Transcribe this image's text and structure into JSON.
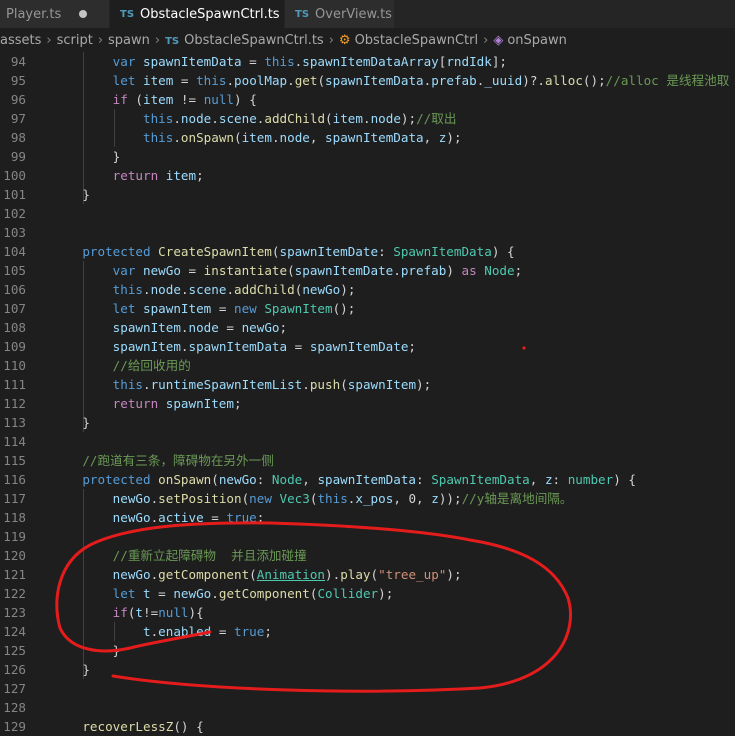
{
  "tabs": [
    {
      "label": "Player.ts",
      "icon": "ts-file-icon",
      "modified": true,
      "active": false
    },
    {
      "label": "ObstacleSpawnCtrl.ts",
      "icon": "ts-file-icon",
      "modified": true,
      "active": true
    },
    {
      "label": "OverView.ts",
      "icon": "ts-file-icon",
      "modified": false,
      "active": false
    }
  ],
  "breadcrumb": {
    "items": [
      "assets",
      "script",
      "spawn",
      "ObstacleSpawnCtrl.ts",
      "ObstacleSpawnCtrl",
      "onSpawn"
    ],
    "ts_label": "TS"
  },
  "annotation": {
    "color": "#e51c1c",
    "shape": "hand-drawn-ellipse"
  },
  "marker_dot": {
    "color": "#e51c1c"
  },
  "lines": [
    {
      "n": "94",
      "t": [
        [
          "kw",
          "        var "
        ],
        [
          "va",
          "spawnItemData"
        ],
        [
          "pl",
          " = "
        ],
        [
          "kw",
          "this"
        ],
        [
          "pl",
          "."
        ],
        [
          "va",
          "spawnItemDataArray"
        ],
        [
          "pl",
          "["
        ],
        [
          "va",
          "rndIdk"
        ],
        [
          "pl",
          "];"
        ]
      ]
    },
    {
      "n": "95",
      "t": [
        [
          "kw",
          "        let "
        ],
        [
          "va",
          "item"
        ],
        [
          "pl",
          " = "
        ],
        [
          "kw",
          "this"
        ],
        [
          "pl",
          "."
        ],
        [
          "va",
          "poolMap"
        ],
        [
          "pl",
          "."
        ],
        [
          "fn",
          "get"
        ],
        [
          "pl",
          "("
        ],
        [
          "va",
          "spawnItemData"
        ],
        [
          "pl",
          "."
        ],
        [
          "va",
          "prefab"
        ],
        [
          "pl",
          "."
        ],
        [
          "va",
          "_uuid"
        ],
        [
          "pl",
          ")?."
        ],
        [
          "fn",
          "alloc"
        ],
        [
          "pl",
          "();"
        ],
        [
          "cm",
          "//alloc 是线程池取"
        ]
      ]
    },
    {
      "n": "96",
      "t": [
        [
          "ct",
          "        if "
        ],
        [
          "pl",
          "("
        ],
        [
          "va",
          "item"
        ],
        [
          "pl",
          " != "
        ],
        [
          "kw",
          "null"
        ],
        [
          "pl",
          ") {"
        ]
      ]
    },
    {
      "n": "97",
      "t": [
        [
          "kw",
          "            this"
        ],
        [
          "pl",
          "."
        ],
        [
          "va",
          "node"
        ],
        [
          "pl",
          "."
        ],
        [
          "va",
          "scene"
        ],
        [
          "pl",
          "."
        ],
        [
          "fn",
          "addChild"
        ],
        [
          "pl",
          "("
        ],
        [
          "va",
          "item"
        ],
        [
          "pl",
          "."
        ],
        [
          "va",
          "node"
        ],
        [
          "pl",
          ");"
        ],
        [
          "cm",
          "//取出"
        ]
      ]
    },
    {
      "n": "98",
      "t": [
        [
          "kw",
          "            this"
        ],
        [
          "pl",
          "."
        ],
        [
          "fn",
          "onSpawn"
        ],
        [
          "pl",
          "("
        ],
        [
          "va",
          "item"
        ],
        [
          "pl",
          "."
        ],
        [
          "va",
          "node"
        ],
        [
          "pl",
          ", "
        ],
        [
          "va",
          "spawnItemData"
        ],
        [
          "pl",
          ", "
        ],
        [
          "va",
          "z"
        ],
        [
          "pl",
          ");"
        ]
      ]
    },
    {
      "n": "99",
      "t": [
        [
          "pl",
          "        }"
        ]
      ]
    },
    {
      "n": "100",
      "t": [
        [
          "ct",
          "        return "
        ],
        [
          "va",
          "item"
        ],
        [
          "pl",
          ";"
        ]
      ]
    },
    {
      "n": "101",
      "t": [
        [
          "pl",
          "    }"
        ]
      ]
    },
    {
      "n": "102",
      "t": []
    },
    {
      "n": "103",
      "t": []
    },
    {
      "n": "104",
      "t": [
        [
          "kw",
          "    protected "
        ],
        [
          "fn",
          "CreateSpawnItem"
        ],
        [
          "pl",
          "("
        ],
        [
          "va",
          "spawnItemDate"
        ],
        [
          "pl",
          ": "
        ],
        [
          "ty",
          "SpawnItemData"
        ],
        [
          "pl",
          ") {"
        ]
      ]
    },
    {
      "n": "105",
      "t": [
        [
          "kw",
          "        var "
        ],
        [
          "va",
          "newGo"
        ],
        [
          "pl",
          " = "
        ],
        [
          "fn",
          "instantiate"
        ],
        [
          "pl",
          "("
        ],
        [
          "va",
          "spawnItemDate"
        ],
        [
          "pl",
          "."
        ],
        [
          "va",
          "prefab"
        ],
        [
          "pl",
          ") "
        ],
        [
          "ct",
          "as "
        ],
        [
          "ty",
          "Node"
        ],
        [
          "pl",
          ";"
        ]
      ]
    },
    {
      "n": "106",
      "t": [
        [
          "kw",
          "        this"
        ],
        [
          "pl",
          "."
        ],
        [
          "va",
          "node"
        ],
        [
          "pl",
          "."
        ],
        [
          "va",
          "scene"
        ],
        [
          "pl",
          "."
        ],
        [
          "fn",
          "addChild"
        ],
        [
          "pl",
          "("
        ],
        [
          "va",
          "newGo"
        ],
        [
          "pl",
          ");"
        ]
      ]
    },
    {
      "n": "107",
      "t": [
        [
          "kw",
          "        let "
        ],
        [
          "va",
          "spawnItem"
        ],
        [
          "pl",
          " = "
        ],
        [
          "kw",
          "new "
        ],
        [
          "ty",
          "SpawnItem"
        ],
        [
          "pl",
          "();"
        ]
      ]
    },
    {
      "n": "108",
      "t": [
        [
          "va",
          "        spawnItem"
        ],
        [
          "pl",
          "."
        ],
        [
          "va",
          "node"
        ],
        [
          "pl",
          " = "
        ],
        [
          "va",
          "newGo"
        ],
        [
          "pl",
          ";"
        ]
      ]
    },
    {
      "n": "109",
      "t": [
        [
          "va",
          "        spawnItem"
        ],
        [
          "pl",
          "."
        ],
        [
          "va",
          "spawnItemData"
        ],
        [
          "pl",
          " = "
        ],
        [
          "va",
          "spawnItemDate"
        ],
        [
          "pl",
          ";"
        ]
      ]
    },
    {
      "n": "110",
      "t": [
        [
          "cm",
          "        //给回收用的"
        ]
      ]
    },
    {
      "n": "111",
      "t": [
        [
          "kw",
          "        this"
        ],
        [
          "pl",
          "."
        ],
        [
          "va",
          "runtimeSpawnItemList"
        ],
        [
          "pl",
          "."
        ],
        [
          "fn",
          "push"
        ],
        [
          "pl",
          "("
        ],
        [
          "va",
          "spawnItem"
        ],
        [
          "pl",
          ");"
        ]
      ]
    },
    {
      "n": "112",
      "t": [
        [
          "ct",
          "        return "
        ],
        [
          "va",
          "spawnItem"
        ],
        [
          "pl",
          ";"
        ]
      ]
    },
    {
      "n": "113",
      "t": [
        [
          "pl",
          "    }"
        ]
      ]
    },
    {
      "n": "114",
      "t": []
    },
    {
      "n": "115",
      "t": [
        [
          "cm",
          "    //跑道有三条，障碍物在另外一侧"
        ]
      ]
    },
    {
      "n": "116",
      "t": [
        [
          "kw",
          "    protected "
        ],
        [
          "fn",
          "onSpawn"
        ],
        [
          "pl",
          "("
        ],
        [
          "va",
          "newGo"
        ],
        [
          "pl",
          ": "
        ],
        [
          "ty",
          "Node"
        ],
        [
          "pl",
          ", "
        ],
        [
          "va",
          "spawnItemData"
        ],
        [
          "pl",
          ": "
        ],
        [
          "ty",
          "SpawnItemData"
        ],
        [
          "pl",
          ", "
        ],
        [
          "va",
          "z"
        ],
        [
          "pl",
          ": "
        ],
        [
          "ty",
          "number"
        ],
        [
          "pl",
          ") {"
        ]
      ]
    },
    {
      "n": "117",
      "t": [
        [
          "va",
          "        newGo"
        ],
        [
          "pl",
          "."
        ],
        [
          "fn",
          "setPosition"
        ],
        [
          "pl",
          "("
        ],
        [
          "kw",
          "new "
        ],
        [
          "ty",
          "Vec3"
        ],
        [
          "pl",
          "("
        ],
        [
          "kw",
          "this"
        ],
        [
          "pl",
          "."
        ],
        [
          "va",
          "x_pos"
        ],
        [
          "pl",
          ", 0, "
        ],
        [
          "va",
          "z"
        ],
        [
          "pl",
          "));"
        ],
        [
          "cm",
          "//y轴是离地间隔。"
        ]
      ]
    },
    {
      "n": "118",
      "t": [
        [
          "va",
          "        newGo"
        ],
        [
          "pl",
          "."
        ],
        [
          "va",
          "active"
        ],
        [
          "pl",
          " = "
        ],
        [
          "kw",
          "true"
        ],
        [
          "pl",
          ";"
        ]
      ]
    },
    {
      "n": "119",
      "t": []
    },
    {
      "n": "120",
      "t": [
        [
          "cm",
          "        //重新立起障碍物  并且添加碰撞"
        ]
      ]
    },
    {
      "n": "121",
      "t": [
        [
          "va",
          "        newGo"
        ],
        [
          "pl",
          "."
        ],
        [
          "fn",
          "getComponent"
        ],
        [
          "pl",
          "("
        ],
        [
          "ty ul",
          "Animation"
        ],
        [
          "pl",
          ")."
        ],
        [
          "fn",
          "play"
        ],
        [
          "pl",
          "("
        ],
        [
          "st",
          "\"tree_up\""
        ],
        [
          "pl",
          ");"
        ]
      ]
    },
    {
      "n": "122",
      "t": [
        [
          "kw",
          "        let "
        ],
        [
          "va",
          "t"
        ],
        [
          "pl",
          " = "
        ],
        [
          "va",
          "newGo"
        ],
        [
          "pl",
          "."
        ],
        [
          "fn",
          "getComponent"
        ],
        [
          "pl",
          "("
        ],
        [
          "ty",
          "Collider"
        ],
        [
          "pl",
          ");"
        ]
      ]
    },
    {
      "n": "123",
      "t": [
        [
          "ct",
          "        if"
        ],
        [
          "pl",
          "("
        ],
        [
          "va",
          "t"
        ],
        [
          "pl",
          "!="
        ],
        [
          "kw",
          "null"
        ],
        [
          "pl",
          "){"
        ]
      ]
    },
    {
      "n": "124",
      "t": [
        [
          "va",
          "            t"
        ],
        [
          "pl",
          "."
        ],
        [
          "va",
          "enabled"
        ],
        [
          "pl",
          " = "
        ],
        [
          "kw",
          "true"
        ],
        [
          "pl",
          ";"
        ]
      ]
    },
    {
      "n": "125",
      "t": [
        [
          "pl",
          "        }"
        ]
      ]
    },
    {
      "n": "126",
      "t": [
        [
          "pl",
          "    }"
        ]
      ]
    },
    {
      "n": "127",
      "t": []
    },
    {
      "n": "128",
      "t": []
    },
    {
      "n": "129",
      "t": [
        [
          "fn",
          "    recoverLessZ"
        ],
        [
          "pl",
          "() {"
        ]
      ]
    }
  ]
}
